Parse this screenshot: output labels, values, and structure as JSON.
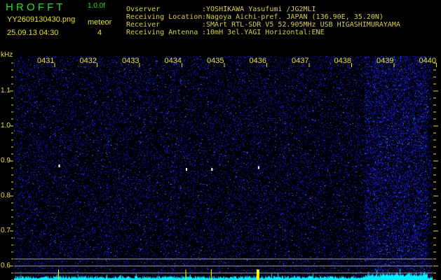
{
  "header": {
    "app_name": "H R O F F T",
    "version": "1.0.0f",
    "filename": "YY2609130430.png",
    "datetime": "25.09.13 04:30",
    "meteor_label": "meteor",
    "meteor_count": "4",
    "info": [
      {
        "label": "Ovserver",
        "value": ":YOSHIKAWA Yasufumi /JG2MLI"
      },
      {
        "label": "Receiving Location",
        "value": ":Nagoya Aichi-pref. JAPAN (136.90E, 35.20N)"
      },
      {
        "label": "Receiver",
        "value": ":SMArt RTL-SDR V5 52.905MHz USB HIGASHIMURAYAMA"
      },
      {
        "label": "Receiving Antenna",
        "value": ":10mH 3el.YAGI Horizontal:ENE"
      }
    ]
  },
  "chart_data": {
    "type": "heatmap",
    "title": "HROFFT spectrogram",
    "ylabel": "kHz",
    "ylim": [
      0.56,
      1.2
    ],
    "x_tick_labels": [
      "0431",
      "0432",
      "0433",
      "0434",
      "0435",
      "0436",
      "0437",
      "0438",
      "0439",
      "0440"
    ],
    "y_tick_labels": [
      "1.1",
      "1.0",
      "0.9",
      "0.8",
      "0.7",
      "0.6"
    ],
    "y_ticks": [
      1.1,
      1.0,
      0.9,
      0.8,
      0.7,
      0.6
    ],
    "meteor_echoes": [
      {
        "time_min": 31.6,
        "freq_khz": 0.89
      },
      {
        "time_min": 34.6,
        "freq_khz": 0.88
      },
      {
        "time_min": 35.2,
        "freq_khz": 0.88
      },
      {
        "time_min": 36.3,
        "freq_khz": 0.885
      }
    ],
    "colors": {
      "background": "#000010",
      "noise": "#1a1aff",
      "histogram": "#00ffff",
      "detection": "#ffff00",
      "guide_lines": "#a0a0a0"
    }
  }
}
